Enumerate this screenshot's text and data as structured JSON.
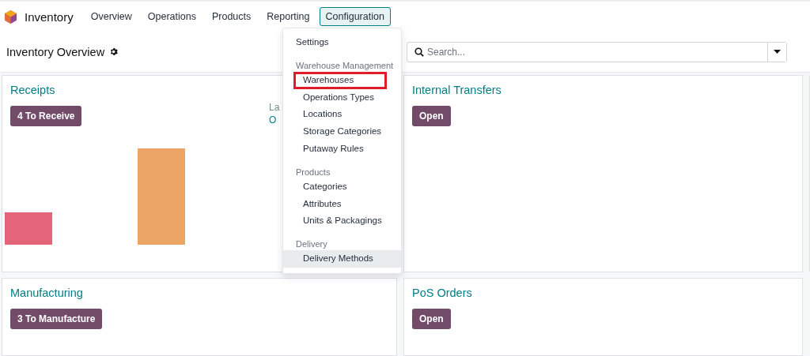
{
  "app": {
    "name": "Inventory"
  },
  "nav": [
    {
      "label": "Overview",
      "selected": false
    },
    {
      "label": "Operations",
      "selected": false
    },
    {
      "label": "Products",
      "selected": false
    },
    {
      "label": "Reporting",
      "selected": false
    },
    {
      "label": "Configuration",
      "selected": true
    }
  ],
  "page_title": "Inventory Overview",
  "search": {
    "placeholder": "Search..."
  },
  "menu": {
    "sections": [
      {
        "items": [
          {
            "label": "Settings",
            "outlined": false,
            "hovered": false
          }
        ]
      },
      {
        "heading": "Warehouse Management",
        "items": [
          {
            "label": "Warehouses",
            "outlined": true,
            "hovered": false
          },
          {
            "label": "Operations Types",
            "outlined": false,
            "hovered": false
          },
          {
            "label": "Locations",
            "outlined": false,
            "hovered": false
          },
          {
            "label": "Storage Categories",
            "outlined": false,
            "hovered": false
          },
          {
            "label": "Putaway Rules",
            "outlined": false,
            "hovered": false
          }
        ]
      },
      {
        "heading": "Products",
        "items": [
          {
            "label": "Categories",
            "outlined": false,
            "hovered": false
          },
          {
            "label": "Attributes",
            "outlined": false,
            "hovered": false
          },
          {
            "label": "Units & Packagings",
            "outlined": false,
            "hovered": false
          }
        ]
      },
      {
        "heading": "Delivery",
        "items": [
          {
            "label": "Delivery Methods",
            "outlined": false,
            "hovered": true
          }
        ]
      }
    ]
  },
  "cards": [
    {
      "kind": "chart",
      "title": "Receipts",
      "button": "4 To Receive",
      "side_lines": [
        "La",
        "O"
      ]
    },
    {
      "kind": "plain",
      "title": "Internal Transfers",
      "button": "Open"
    },
    {
      "kind": "plain",
      "title": "Manufacturing",
      "button": "3 To Manufacture"
    },
    {
      "kind": "plain",
      "title": "PoS Orders",
      "button": "Open"
    }
  ]
}
